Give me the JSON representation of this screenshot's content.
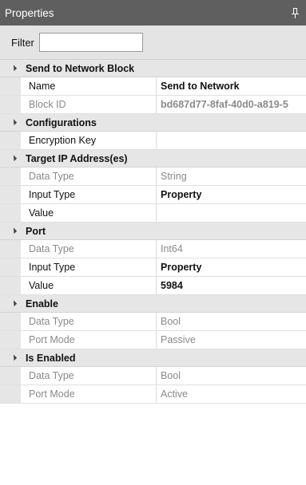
{
  "title": "Properties",
  "filter": {
    "label": "Filter",
    "value": ""
  },
  "categories": [
    {
      "name": "Send to Network Block",
      "rows": [
        {
          "name": "Name",
          "value": "Send to Network",
          "dim": false,
          "bold": true
        },
        {
          "name": "Block ID",
          "value": "bd687d77-8faf-40d0-a819-5",
          "dim": true,
          "bold": true
        }
      ]
    },
    {
      "name": "Configurations",
      "rows": [
        {
          "name": "Encryption Key",
          "value": "",
          "dim": false,
          "bold": false
        }
      ]
    },
    {
      "name": "Target IP Address(es)",
      "rows": [
        {
          "name": "Data Type",
          "value": "String",
          "dim": true,
          "bold": false
        },
        {
          "name": "Input Type",
          "value": "Property",
          "dim": false,
          "bold": true
        },
        {
          "name": "Value",
          "value": "",
          "dim": false,
          "bold": false
        }
      ]
    },
    {
      "name": "Port",
      "rows": [
        {
          "name": "Data Type",
          "value": "Int64",
          "dim": true,
          "bold": false
        },
        {
          "name": "Input Type",
          "value": "Property",
          "dim": false,
          "bold": true
        },
        {
          "name": "Value",
          "value": "5984",
          "dim": false,
          "bold": true
        }
      ]
    },
    {
      "name": "Enable",
      "rows": [
        {
          "name": "Data Type",
          "value": "Bool",
          "dim": true,
          "bold": false
        },
        {
          "name": "Port Mode",
          "value": "Passive",
          "dim": true,
          "bold": false
        }
      ]
    },
    {
      "name": "Is Enabled",
      "rows": [
        {
          "name": "Data Type",
          "value": "Bool",
          "dim": true,
          "bold": false
        },
        {
          "name": "Port Mode",
          "value": "Active",
          "dim": true,
          "bold": false
        }
      ]
    }
  ]
}
